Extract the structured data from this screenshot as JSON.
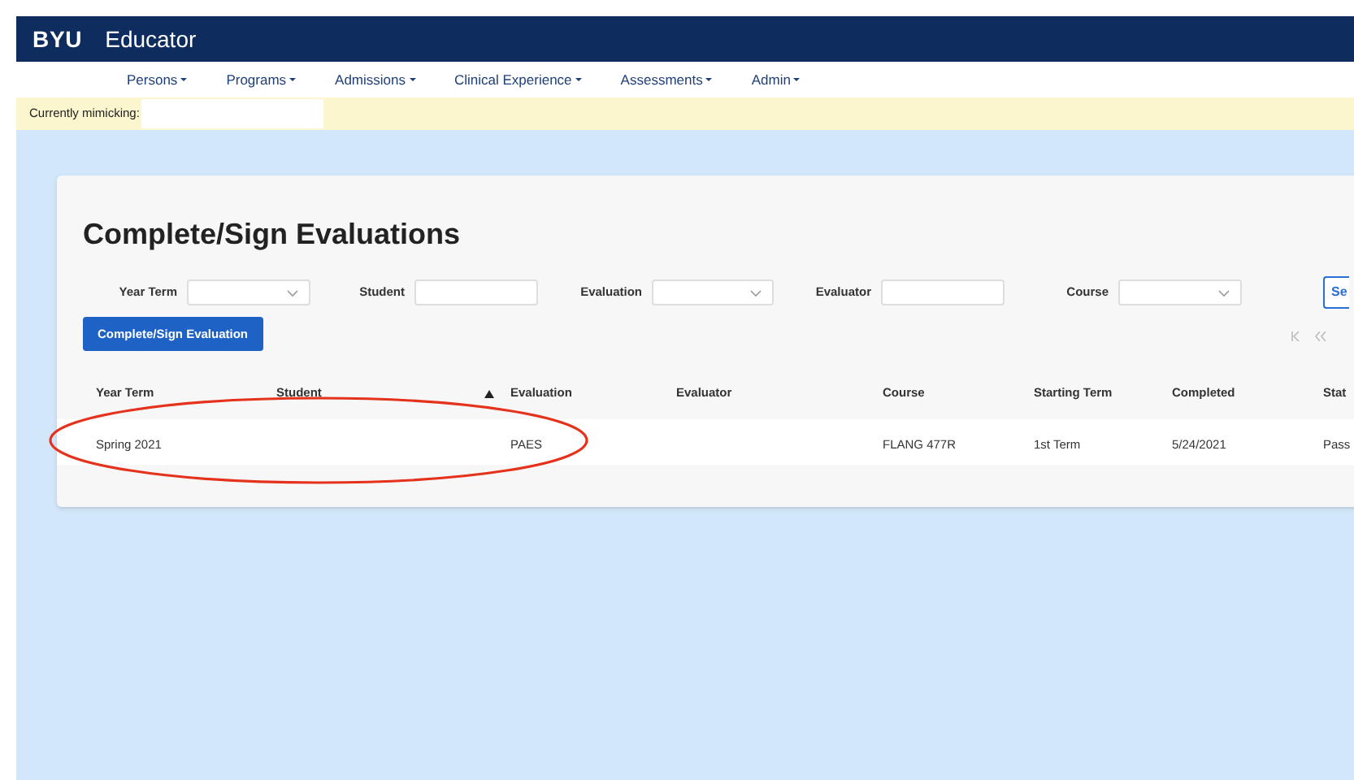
{
  "header": {
    "logo": "BYU",
    "app_name": "Educator"
  },
  "nav": [
    {
      "label": "Persons"
    },
    {
      "label": "Programs"
    },
    {
      "label": "Admissions"
    },
    {
      "label": "Clinical Experience"
    },
    {
      "label": "Assessments"
    },
    {
      "label": "Admin"
    }
  ],
  "mimic_bar": {
    "label": "Currently mimicking:"
  },
  "page": {
    "title": "Complete/Sign Evaluations",
    "filters": [
      {
        "label": "Year Term",
        "kind": "select"
      },
      {
        "label": "Student",
        "kind": "text"
      },
      {
        "label": "Evaluation",
        "kind": "select"
      },
      {
        "label": "Evaluator",
        "kind": "text"
      },
      {
        "label": "Course",
        "kind": "select"
      }
    ],
    "search_button": "Se",
    "action_button": "Complete/Sign Evaluation",
    "table": {
      "columns": [
        {
          "label": "Year Term",
          "sorted": false
        },
        {
          "label": "Student",
          "sorted": true
        },
        {
          "label": "Evaluation",
          "sorted": false
        },
        {
          "label": "Evaluator",
          "sorted": false
        },
        {
          "label": "Course",
          "sorted": false
        },
        {
          "label": "Starting Term",
          "sorted": false
        },
        {
          "label": "Completed",
          "sorted": false
        },
        {
          "label": "Stat"
        }
      ],
      "rows": [
        {
          "cells": [
            "Spring 2021",
            "",
            "PAES",
            "",
            "FLANG 477R",
            "1st Term",
            "5/24/2021",
            "Pass"
          ],
          "highlighted": true
        }
      ]
    }
  }
}
